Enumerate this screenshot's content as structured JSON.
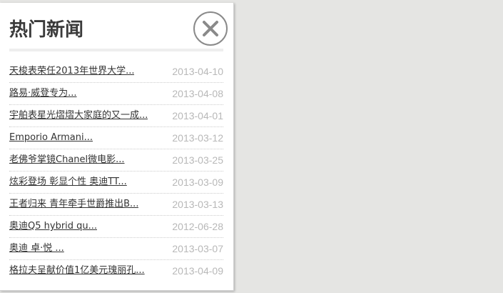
{
  "panel": {
    "title": "热门新闻",
    "close_icon": "close-x-icon"
  },
  "news": [
    {
      "title": "天梭表荣任2013年世界大学...",
      "date": "2013-04-10"
    },
    {
      "title": "路易·威登专为...",
      "date": "2013-04-08"
    },
    {
      "title": "宇舶表星光熠熠大家庭的又一成...",
      "date": "2013-04-01"
    },
    {
      "title": "Emporio Armani...",
      "date": "2013-03-12"
    },
    {
      "title": "老佛爷掌镜Chanel微电影...",
      "date": "2013-03-25"
    },
    {
      "title": "炫彩登场 彰显个性 奥迪TT...",
      "date": "2013-03-09"
    },
    {
      "title": "王者归来 青年牵手世爵推出B...",
      "date": "2013-03-13"
    },
    {
      "title": "奥迪Q5 hybrid qu...",
      "date": "2012-06-28"
    },
    {
      "title": "奥迪 卓·悦 ...",
      "date": "2013-03-07"
    },
    {
      "title": "格拉夫呈献价值1亿美元瑰丽孔...",
      "date": "2013-04-09"
    }
  ]
}
